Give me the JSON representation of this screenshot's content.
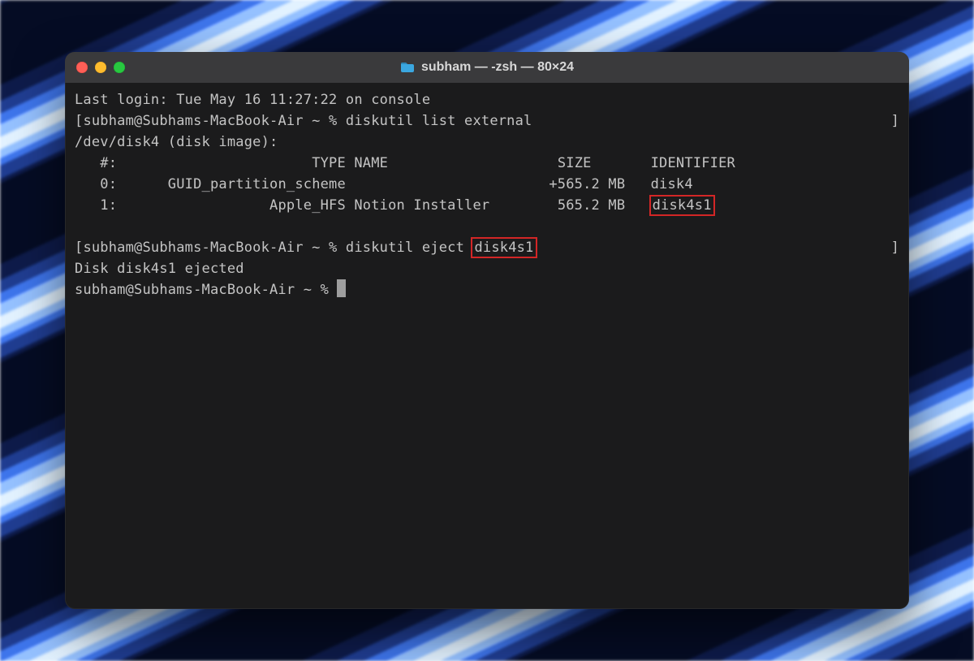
{
  "window": {
    "title": "subham — -zsh — 80×24"
  },
  "term": {
    "last_login": "Last login: Tue May 16 11:27:22 on console",
    "prompt1_user": "subham@Subhams-MacBook-Air ~ % ",
    "cmd1": "diskutil list external",
    "dev_line": "/dev/disk4 (disk image):",
    "header_num": "   #:",
    "header_type": "                       TYPE",
    "header_name": " NAME",
    "header_size": "                    SIZE",
    "header_ident": "       IDENTIFIER",
    "row0_num": "   0:",
    "row0_type": "      GUID_partition_scheme",
    "row0_name": "                        ",
    "row0_size": "+565.2 MB",
    "row0_ident": "   disk4",
    "row1_num": "   1:",
    "row1_type": "                  Apple_HFS",
    "row1_name": " Notion Installer        ",
    "row1_size": "565.2 MB",
    "row1_ident_sp": "   ",
    "row1_ident": "disk4s1",
    "prompt2_user": "subham@Subhams-MacBook-Air ~ % ",
    "cmd2_pre": "diskutil eject ",
    "cmd2_arg": "disk4s1",
    "ejected": "Disk disk4s1 ejected",
    "prompt3_user": "subham@Subhams-MacBook-Air ~ % "
  }
}
